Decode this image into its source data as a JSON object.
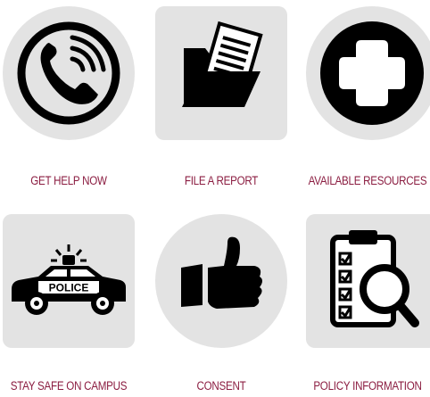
{
  "colors": {
    "tile_background": "#e3e3e3",
    "icon": "#000000",
    "label": "#8b1d41"
  },
  "tiles": [
    {
      "label": "GET HELP NOW",
      "icon": "phone-icon"
    },
    {
      "label": "FILE A REPORT",
      "icon": "folder-document-icon"
    },
    {
      "label": "AVAILABLE RESOURCES",
      "icon": "medical-cross-icon"
    },
    {
      "label": "STAY SAFE ON CAMPUS",
      "icon": "police-car-icon"
    },
    {
      "label": "CONSENT",
      "icon": "thumbs-up-icon"
    },
    {
      "label": "POLICY INFORMATION",
      "icon": "clipboard-magnifier-icon"
    }
  ]
}
